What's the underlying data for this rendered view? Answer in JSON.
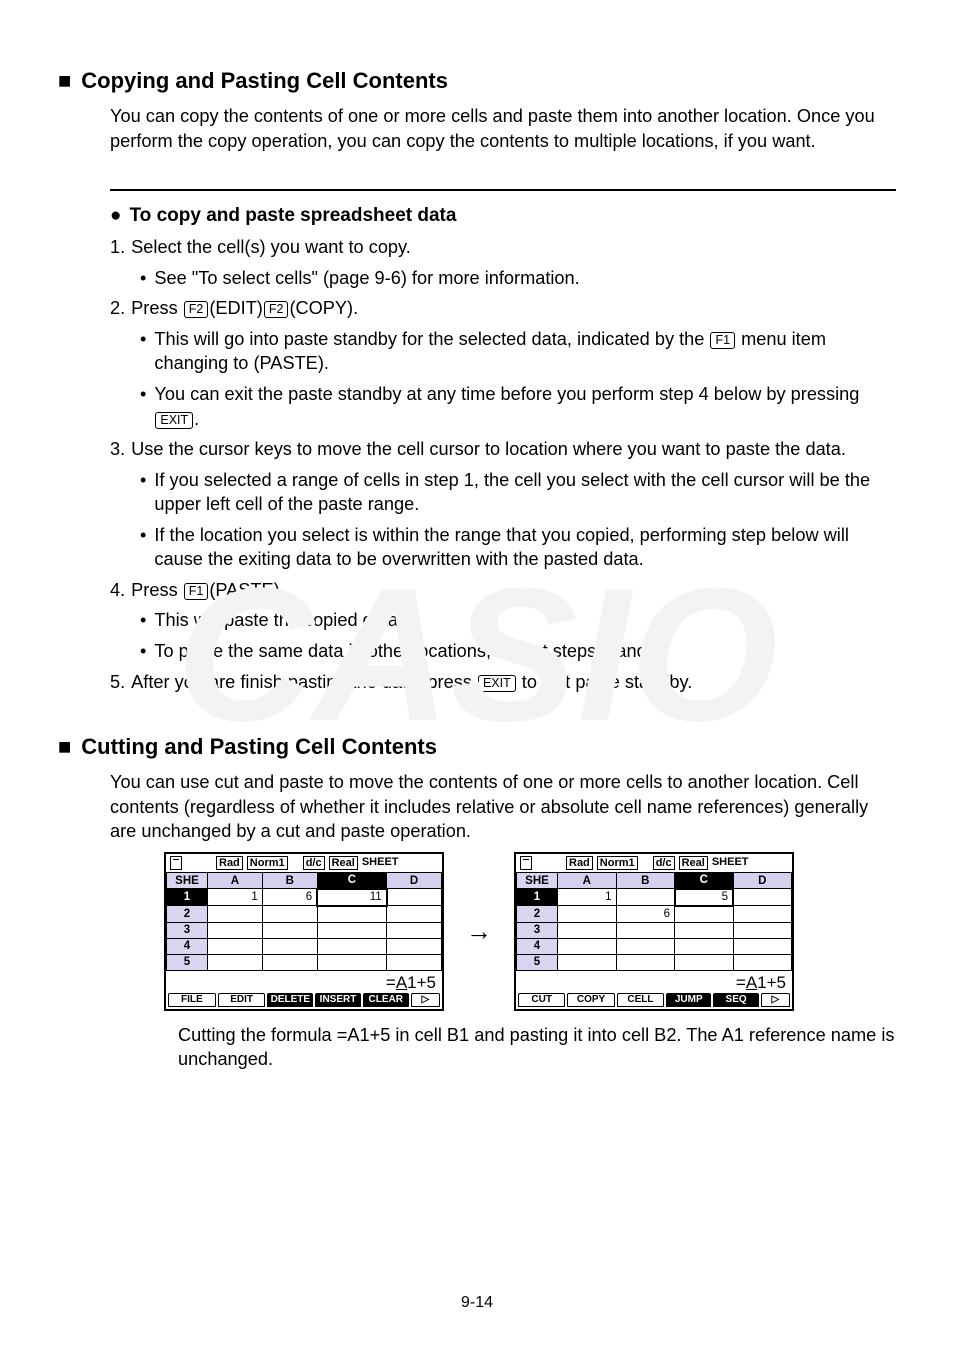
{
  "section1": {
    "title": "Copying and Pasting Cell Contents",
    "intro": "You can copy the contents of one or more cells and paste them into another location. Once you perform the copy operation, you can copy the contents to multiple locations, if you want.",
    "sub_title": "To copy and paste spreadsheet data",
    "step1": "Select the cell(s) you want to copy.",
    "step1_b1": "See \"To select cells\" (page 9-6) for more information.",
    "step2_pre": "Press ",
    "step2_k1": "F2",
    "step2_mid1": "(EDIT)",
    "step2_k2": "F2",
    "step2_mid2": "(COPY).",
    "step2_b1_pre": "This will go into paste standby for the selected data, indicated by the ",
    "step2_b1_k": "F1",
    "step2_b1_post": " menu item changing to (PASTE).",
    "step2_b2_pre": "You can exit the paste standby at any time before you perform step 4 below by pressing ",
    "step2_b2_k": "EXIT",
    "step2_b2_post": ".",
    "step3": "Use the cursor keys to move the cell cursor to location where you want to paste the data.",
    "step3_b1": "If you selected a range of cells in step 1, the cell you select with the cell cursor will be the upper left cell of the paste range.",
    "step3_b2": "If the location you select is within the range that you copied, performing step below will cause the exiting data to be overwritten with the pasted data.",
    "step4_pre": "Press ",
    "step4_k": "F1",
    "step4_post": "(PASTE).",
    "step4_b1": "This will paste the copied data.",
    "step4_b2": "To paste the same data in other locations, repeat steps 3 and 4.",
    "step5_pre": "After you are finish pasting the data, press ",
    "step5_k": "EXIT",
    "step5_post": " to exit paste standby."
  },
  "section2": {
    "title": "Cutting and Pasting Cell Contents",
    "intro": "You can use cut and paste to move the contents of one or more cells to another location. Cell contents (regardless of whether it includes relative or absolute cell name references) generally are unchanged by a cut and paste operation.",
    "caption": "Cutting the formula =A1+5 in cell B1 and pasting it into cell B2. The A1 reference name is unchanged."
  },
  "screens": {
    "status": {
      "b1": "Rad",
      "b2": "Norm1",
      "b3": "d/c",
      "b4": "Real"
    },
    "sheet_label": "SHEET",
    "row_label": "SHE",
    "cols": [
      "A",
      "B",
      "C",
      "D"
    ],
    "rows": [
      "1",
      "2",
      "3",
      "4",
      "5"
    ],
    "left": {
      "cells": {
        "A1": "1",
        "B1": "6",
        "C1": "11"
      },
      "formula": "=A1+5",
      "softkeys": [
        "FILE",
        "EDIT",
        "DELETE",
        "INSERT",
        "CLEAR",
        "▷"
      ]
    },
    "right": {
      "cells": {
        "A1": "1",
        "C1": "5",
        "B2": "6"
      },
      "formula": "=A1+5",
      "softkeys": [
        "CUT",
        "COPY",
        "CELL",
        "JUMP",
        "SEQ",
        "▷"
      ]
    }
  },
  "arrow": "→",
  "page_number": "9-14"
}
